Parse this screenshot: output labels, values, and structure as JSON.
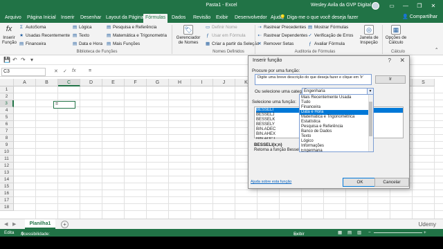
{
  "window": {
    "title": "Pasta1 - Excel",
    "user": "Wesley Avila da GVP Digital",
    "share": "Compartilhar",
    "tell_me": "Diga-me o que você deseja fazer"
  },
  "tabs": [
    "Arquivo",
    "Página Inicial",
    "Inserir",
    "Desenhar",
    "Layout da Página",
    "Fórmulas",
    "Dados",
    "Revisão",
    "Exibir",
    "Desenvolvedor",
    "Ajuda"
  ],
  "active_tab": "Fórmulas",
  "ribbon": {
    "insert_function": "Inserir\nFunção",
    "insert_function_l1": "Inserir",
    "insert_function_l2": "Função",
    "library": [
      "AutoSoma",
      "Usadas Recentemente",
      "Financeira",
      "Lógica",
      "Texto",
      "Data e Hora",
      "Pesquisa e Referência",
      "Matemática e Trigonometria",
      "Mais Funções"
    ],
    "library_group": "Biblioteca de Funções",
    "name_manager_l1": "Gerenciador",
    "name_manager_l2": "de Nomes",
    "define_name": "Definir Nome",
    "use_in_formula": "Usar em Fórmula",
    "create_from_selection": "Criar a partir da Seleção",
    "names_group": "Nomes Definidos",
    "audit": [
      "Rastrear Precedentes",
      "Rastrear Dependentes",
      "Remover Setas",
      "Mostrar Fórmulas",
      "Verificação de Erros",
      "Avaliar Fórmula"
    ],
    "audit_group": "Auditoria de Fórmulas",
    "watch_l1": "Janela de",
    "watch_l2": "Inspeção",
    "calc_options_l1": "Opções de",
    "calc_options_l2": "Cálculo",
    "calc_group": "Cálculo"
  },
  "formula_bar": {
    "name_box": "C3",
    "formula": "="
  },
  "columns": [
    "A",
    "B",
    "C",
    "D",
    "E",
    "F",
    "G",
    "H",
    "I",
    "J",
    "K",
    "L",
    "M",
    "N",
    "O",
    "P",
    "Q",
    "R",
    "S"
  ],
  "rows": [
    "1",
    "2",
    "3",
    "4",
    "5",
    "6",
    "7",
    "8",
    "9",
    "10",
    "11",
    "12",
    "13",
    "14",
    "15",
    "16",
    "17",
    "18"
  ],
  "active_cell_value": "=",
  "sheet_tab": "Planilha1",
  "status": {
    "left": "Edita",
    "accessibility": "Acessibilidade: tudo certo",
    "display": "Exibir Configurações"
  },
  "watermark": "Udemy",
  "dialog": {
    "title": "Inserir função",
    "search_label": "Procure por uma função:",
    "search_text": "Digite uma breve descrição do que deseja fazer e clique em 'Ir'",
    "go_button": "Ir",
    "category_label": "Ou selecione uma categoria:",
    "category_value": "Engenharia",
    "function_label": "Selecione uma função:",
    "functions": [
      "BESSELI",
      "BESSELJ",
      "BESSELK",
      "BESSELY",
      "BIN.ADEC",
      "BIN.AHEX",
      "BIN.AOCT"
    ],
    "selected_function": "BESSELI",
    "categories": [
      "Mais Recentemente Usada",
      "Tudo",
      "Financeira",
      "Data e Hora",
      "Matemática e Trigonométrica",
      "Estatística",
      "Pesquisa e Referência",
      "Banco de Dados",
      "Texto",
      "Lógico",
      "Informações",
      "Engenharia"
    ],
    "highlighted_category": "Data e Hora",
    "signature": "BESSELI(x;n)",
    "description": "Retorna a função Bessel mod",
    "help_link": "Ajuda sobre esta função",
    "ok": "OK",
    "cancel": "Cancelar"
  }
}
